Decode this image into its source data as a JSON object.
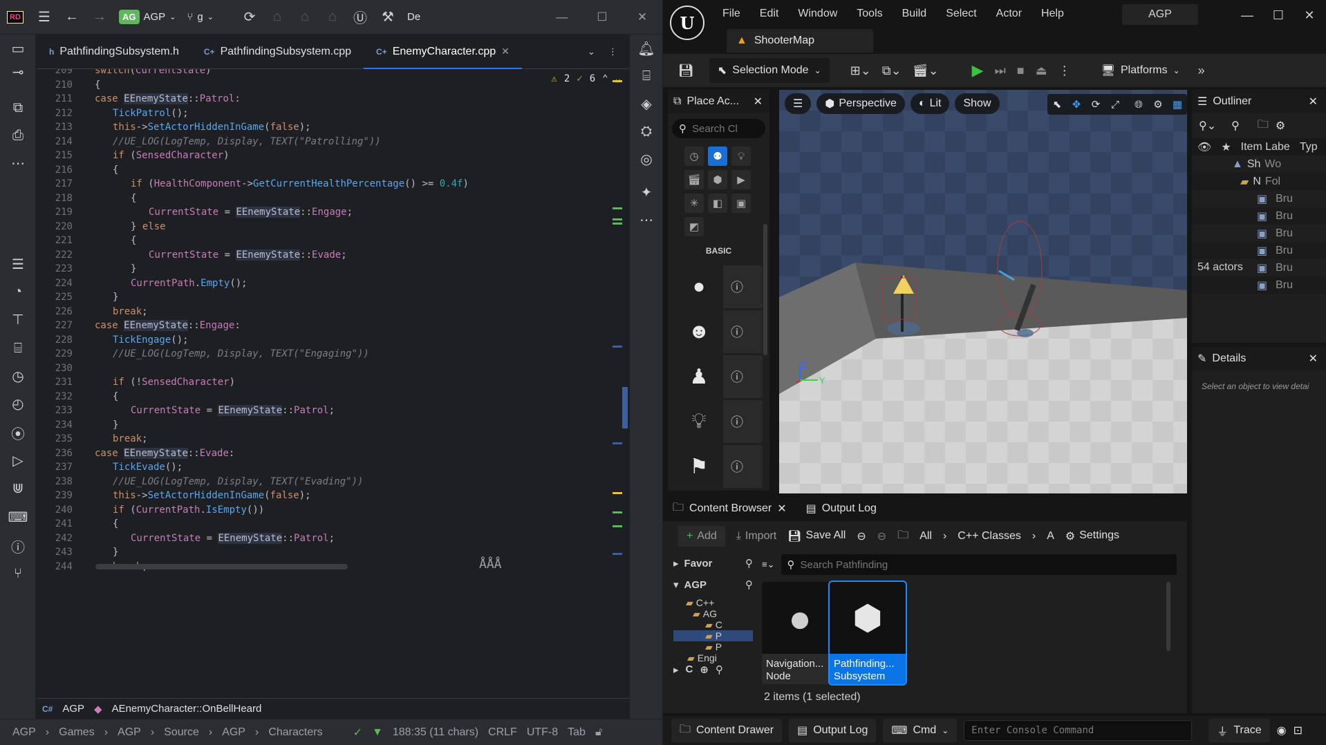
{
  "ide": {
    "title": {
      "project_badge": "AG",
      "project_name": "AGP",
      "branch": "g",
      "config_label": "De"
    },
    "tabs": [
      {
        "label": "PathfindingSubsystem.h",
        "ext": "h"
      },
      {
        "label": "PathfindingSubsystem.cpp",
        "ext": "C+"
      },
      {
        "label": "EnemyCharacter.cpp",
        "ext": "C+",
        "active": true
      }
    ],
    "inspections": {
      "warnings": "2",
      "ok": "6"
    },
    "code_lines": [
      {
        "n": "209",
        "indent": 1,
        "html": "<span class='kw'>switch</span>(<span class='mem'>CurrentState</span>)"
      },
      {
        "n": "210",
        "indent": 1,
        "html": "{"
      },
      {
        "n": "211",
        "indent": 1,
        "html": "<span class='kw'>case</span> <span class='typ'>EEnemyState</span>::<span class='mem'>Patrol</span>:"
      },
      {
        "n": "212",
        "indent": 2,
        "html": "<span class='fn'>TickPatrol</span>();"
      },
      {
        "n": "213",
        "indent": 2,
        "html": "<span class='kw'>this</span>-><span class='fn'>SetActorHiddenInGame</span>(<span class='kw'>false</span>);"
      },
      {
        "n": "214",
        "indent": 2,
        "html": "<span class='cmt'>//UE_LOG(LogTemp, Display, TEXT(\"Patrolling\"))</span>"
      },
      {
        "n": "215",
        "indent": 2,
        "html": "<span class='kw'>if</span> (<span class='mem'>SensedCharacter</span>)"
      },
      {
        "n": "216",
        "indent": 2,
        "html": "{"
      },
      {
        "n": "217",
        "indent": 3,
        "html": "<span class='kw'>if</span> (<span class='mem'>HealthComponent</span>-><span class='fn'>GetCurrentHealthPercentage</span>() >= <span class='num'>0.4f</span>)"
      },
      {
        "n": "218",
        "indent": 3,
        "html": "{"
      },
      {
        "n": "219",
        "indent": 4,
        "html": "<span class='mem'>CurrentState</span> = <span class='typ'>EEnemyState</span>::<span class='mem'>Engage</span>;"
      },
      {
        "n": "220",
        "indent": 3,
        "html": "} <span class='kw'>else</span>"
      },
      {
        "n": "221",
        "indent": 3,
        "html": "{"
      },
      {
        "n": "222",
        "indent": 4,
        "html": "<span class='mem'>CurrentState</span> = <span class='typ'>EEnemyState</span>::<span class='mem'>Evade</span>;"
      },
      {
        "n": "223",
        "indent": 3,
        "html": "}"
      },
      {
        "n": "224",
        "indent": 3,
        "html": "<span class='mem'>CurrentPath</span>.<span class='fn'>Empty</span>();"
      },
      {
        "n": "225",
        "indent": 2,
        "html": "}"
      },
      {
        "n": "226",
        "indent": 2,
        "html": "<span class='kw'>break</span>;"
      },
      {
        "n": "227",
        "indent": 1,
        "html": "<span class='kw'>case</span> <span class='typ'>EEnemyState</span>::<span class='mem'>Engage</span>:"
      },
      {
        "n": "228",
        "indent": 2,
        "html": "<span class='fn'>TickEngage</span>();"
      },
      {
        "n": "229",
        "indent": 2,
        "html": "<span class='cmt'>//UE_LOG(LogTemp, Display, TEXT(\"Engaging\"))</span>"
      },
      {
        "n": "230",
        "indent": 2,
        "html": ""
      },
      {
        "n": "231",
        "indent": 2,
        "html": "<span class='kw'>if</span> (!<span class='mem'>SensedCharacter</span>)"
      },
      {
        "n": "232",
        "indent": 2,
        "html": "{"
      },
      {
        "n": "233",
        "indent": 3,
        "html": "<span class='mem'>CurrentState</span> = <span class='typ'>EEnemyState</span>::<span class='mem'>Patrol</span>;"
      },
      {
        "n": "234",
        "indent": 2,
        "html": "}"
      },
      {
        "n": "235",
        "indent": 2,
        "html": "<span class='kw'>break</span>;"
      },
      {
        "n": "236",
        "indent": 1,
        "html": "<span class='kw'>case</span> <span class='typ'>EEnemyState</span>::<span class='mem'>Evade</span>:"
      },
      {
        "n": "237",
        "indent": 2,
        "html": "<span class='fn'>TickEvade</span>();"
      },
      {
        "n": "238",
        "indent": 2,
        "html": "<span class='cmt'>//UE_LOG(LogTemp, Display, TEXT(\"Evading\"))</span>"
      },
      {
        "n": "239",
        "indent": 2,
        "html": "<span class='kw'>this</span>-><span class='fn'>SetActorHiddenInGame</span>(<span class='kw'>false</span>);"
      },
      {
        "n": "240",
        "indent": 2,
        "html": "<span class='kw'>if</span> (<span class='mem'>CurrentPath</span>.<span class='fn'>IsEmpty</span>())"
      },
      {
        "n": "241",
        "indent": 2,
        "html": "{"
      },
      {
        "n": "242",
        "indent": 3,
        "html": "<span class='mem'>CurrentState</span> = <span class='typ'>EEnemyState</span>::<span class='mem'>Patrol</span>;"
      },
      {
        "n": "243",
        "indent": 2,
        "html": "}"
      },
      {
        "n": "244",
        "indent": 2,
        "html": "<span class='kw'>break</span>;"
      }
    ],
    "breadcrumb_code": {
      "module": "AGP",
      "symbol": "AEnemyCharacter::OnBellHeard"
    },
    "status": {
      "path": [
        "AGP",
        "Games",
        "AGP",
        "Source",
        "AGP",
        "Characters"
      ],
      "position": "188:35 (11 chars)",
      "line_ending": "CRLF",
      "encoding": "UTF-8",
      "indent": "Tab"
    }
  },
  "ue": {
    "menu": [
      "File",
      "Edit",
      "Window",
      "Tools",
      "Build",
      "Select",
      "Actor",
      "Help"
    ],
    "project": "AGP",
    "map_tab": "ShooterMap",
    "toolbar": {
      "selection_mode": "Selection Mode",
      "platforms": "Platforms"
    },
    "place_actors": {
      "title": "Place Ac...",
      "search_placeholder": "Search Cl",
      "category": "BASIC"
    },
    "viewport": {
      "perspective": "Perspective",
      "lit": "Lit",
      "show": "Show"
    },
    "outliner": {
      "title": "Outliner",
      "col_label": "Item Labe",
      "col_type": "Typ",
      "rows": [
        {
          "label": "Sh",
          "type": "Wo"
        },
        {
          "label": "N",
          "type": "Fol"
        },
        {
          "label": "",
          "type": "Bru"
        },
        {
          "label": "",
          "type": "Bru"
        },
        {
          "label": "",
          "type": "Bru"
        },
        {
          "label": "",
          "type": "Bru"
        },
        {
          "label": "",
          "type": "Bru"
        },
        {
          "label": "",
          "type": "Bru"
        }
      ],
      "actor_count": "54 actors"
    },
    "details": {
      "title": "Details",
      "hint": "Select an object to view detai"
    },
    "content_browser": {
      "tab1": "Content Browser",
      "tab2": "Output Log",
      "add": "Add",
      "import": "Import",
      "save_all": "Save All",
      "path": [
        "All",
        "C++ Classes",
        "A"
      ],
      "settings": "Settings",
      "favorites": "Favor",
      "root": "AGP",
      "tree": [
        "C++",
        "AG",
        "C",
        "P",
        "P",
        "Engi"
      ],
      "collections": "C",
      "search_placeholder": "Search Pathfinding",
      "assets": [
        {
          "line1": "Navigation...",
          "line2": "Node",
          "selected": false
        },
        {
          "line1": "Pathfinding...",
          "line2": "Subsystem",
          "selected": true
        }
      ],
      "count": "2 items (1 selected)"
    },
    "status": {
      "content_drawer": "Content Drawer",
      "output_log": "Output Log",
      "cmd": "Cmd",
      "console_placeholder": "Enter Console Command",
      "trace": "Trace"
    }
  }
}
